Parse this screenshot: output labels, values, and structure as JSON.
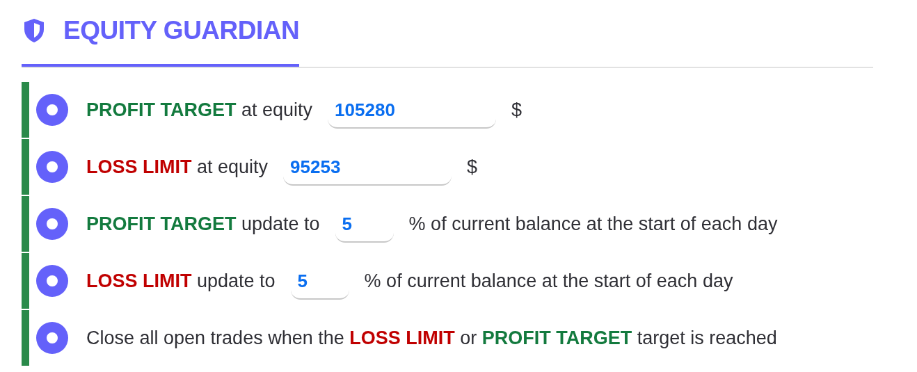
{
  "header": {
    "title": "EQUITY GUARDIAN",
    "selected": true
  },
  "rows": [
    {
      "parts": [
        {
          "kind": "text",
          "runs": [
            {
              "text": "PROFIT TARGET",
              "kind": "profit"
            },
            {
              "text": " at equity",
              "kind": "plain"
            }
          ]
        },
        {
          "kind": "wide-field",
          "value": "105280"
        },
        {
          "kind": "text",
          "runs": [
            {
              "text": "$",
              "kind": "plain"
            }
          ]
        }
      ]
    },
    {
      "parts": [
        {
          "kind": "text",
          "runs": [
            {
              "text": "LOSS LIMIT",
              "kind": "loss"
            },
            {
              "text": " at equity",
              "kind": "plain"
            }
          ]
        },
        {
          "kind": "wide-field",
          "value": "95253"
        },
        {
          "kind": "text",
          "runs": [
            {
              "text": "$",
              "kind": "plain"
            }
          ]
        }
      ]
    },
    {
      "parts": [
        {
          "kind": "text",
          "runs": [
            {
              "text": "PROFIT TARGET",
              "kind": "profit"
            },
            {
              "text": " update to",
              "kind": "plain"
            }
          ]
        },
        {
          "kind": "narrow-field",
          "value": "5"
        },
        {
          "kind": "text",
          "runs": [
            {
              "text": "% of current balance at the start of each day",
              "kind": "plain"
            }
          ]
        }
      ]
    },
    {
      "parts": [
        {
          "kind": "text",
          "runs": [
            {
              "text": "LOSS LIMIT",
              "kind": "loss"
            },
            {
              "text": " update to",
              "kind": "plain"
            }
          ]
        },
        {
          "kind": "narrow-field",
          "value": "5"
        },
        {
          "kind": "text",
          "runs": [
            {
              "text": "% of current balance at the start of each day",
              "kind": "plain"
            }
          ]
        }
      ]
    },
    {
      "parts": [
        {
          "kind": "text",
          "runs": [
            {
              "text": "Close all open trades when the ",
              "kind": "plain"
            },
            {
              "text": "LOSS LIMIT",
              "kind": "loss"
            },
            {
              "text": " or ",
              "kind": "plain"
            },
            {
              "text": "PROFIT TARGET",
              "kind": "profit"
            },
            {
              "text": " target is reached",
              "kind": "plain"
            }
          ]
        }
      ]
    }
  ]
}
